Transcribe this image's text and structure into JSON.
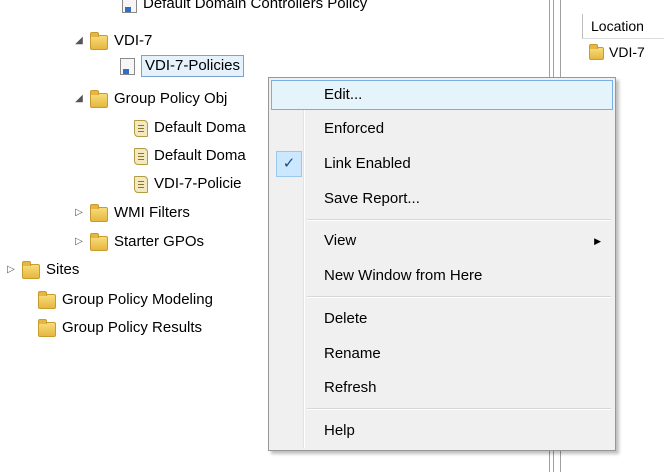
{
  "tree": {
    "top_cut": "Default Domain Controllers Policy",
    "vdi7": "VDI-7",
    "vdi7_policies": "VDI-7-Policies",
    "gpo": "Group Policy Obj",
    "default1": "Default Doma",
    "default2": "Default Doma",
    "vdi7_policie": "VDI-7-Policie",
    "wmi": "WMI Filters",
    "starter": "Starter GPOs",
    "sites": "Sites",
    "modeling": "Group Policy Modeling",
    "results": "Group Policy Results"
  },
  "right_pane": {
    "column_header": "Location",
    "location_value": "VDI-7"
  },
  "menu": {
    "items": [
      {
        "label": "Edit..."
      },
      {
        "label": "Enforced"
      },
      {
        "label": "Link Enabled",
        "checked": true
      },
      {
        "label": "Save Report..."
      },
      {
        "label": "View",
        "submenu": true
      },
      {
        "label": "New Window from Here"
      },
      {
        "label": "Delete"
      },
      {
        "label": "Rename"
      },
      {
        "label": "Refresh"
      },
      {
        "label": "Help"
      }
    ],
    "check_glyph": "✓",
    "submenu_glyph": "▶"
  }
}
